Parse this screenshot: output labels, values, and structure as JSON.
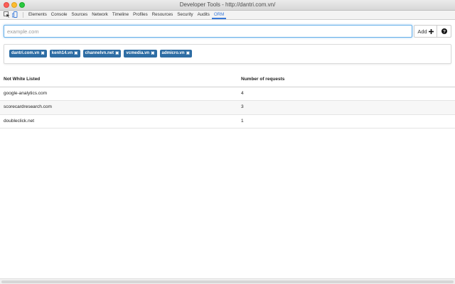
{
  "window": {
    "title": "Developer Tools - http://dantri.com.vn/"
  },
  "toolbar": {
    "inspect_icon": "inspect-element-icon",
    "device_icon": "device-mode-icon",
    "tabs": [
      {
        "label": "Elements"
      },
      {
        "label": "Console"
      },
      {
        "label": "Sources"
      },
      {
        "label": "Network"
      },
      {
        "label": "Timeline"
      },
      {
        "label": "Profiles"
      },
      {
        "label": "Resources"
      },
      {
        "label": "Security"
      },
      {
        "label": "Audits"
      },
      {
        "label": "ORM"
      }
    ],
    "active_tab": "ORM"
  },
  "input": {
    "placeholder": "example.com",
    "value": ""
  },
  "buttons": {
    "add_label": "Add",
    "add_icon": "plus-icon",
    "help_icon": "question-icon"
  },
  "whitelist": {
    "tags": [
      {
        "label": "dantri.com.vn"
      },
      {
        "label": "kenh14.vn"
      },
      {
        "label": "channelvn.net"
      },
      {
        "label": "vcmedia.vn"
      },
      {
        "label": "admicro.vn"
      }
    ],
    "remove_symbol": "✖"
  },
  "table": {
    "headers": [
      "Not White Listed",
      "Number of requests"
    ],
    "rows": [
      {
        "domain": "google-analytics.com",
        "count": "4"
      },
      {
        "domain": "scorecardresearch.com",
        "count": "3"
      },
      {
        "domain": "doubleclick.net",
        "count": "1"
      }
    ]
  },
  "colors": {
    "accent": "#3879d9",
    "tag_bg": "#2e6da4"
  }
}
